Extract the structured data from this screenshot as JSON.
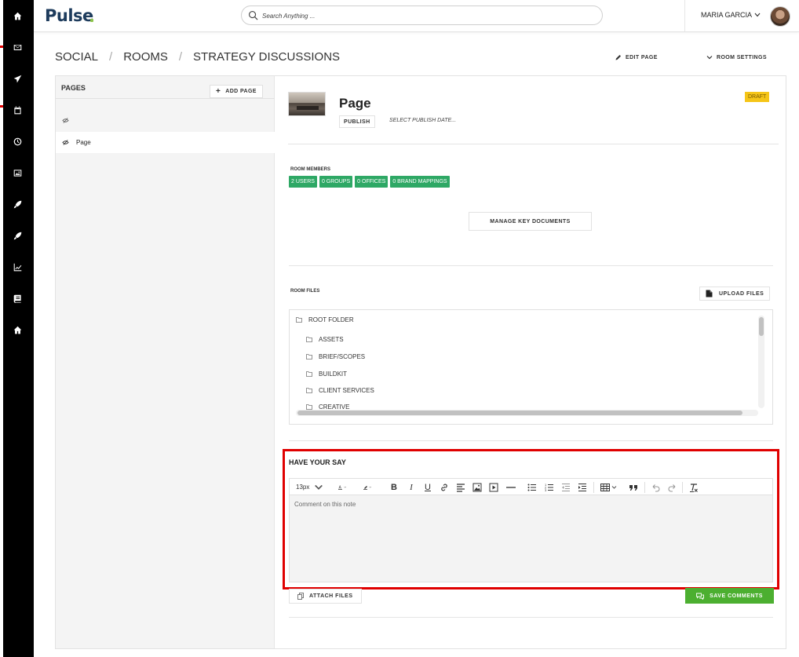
{
  "app": {
    "logo": "Pulse",
    "search_placeholder": "Search Anything ...",
    "user_name": "MARIA GARCIA"
  },
  "rail": {
    "icons": [
      "home-icon",
      "mail-icon",
      "send-icon",
      "calendar-icon",
      "clock-icon",
      "image-icon",
      "rocket-icon",
      "rocket-alt-icon",
      "chart-icon",
      "book-icon",
      "home-alt-icon"
    ]
  },
  "header": {
    "breadcrumb": [
      "SOCIAL",
      "ROOMS",
      "STRATEGY DISCUSSIONS"
    ],
    "separator": "/",
    "edit_page": "EDIT PAGE",
    "room_settings": "ROOM SETTINGS"
  },
  "pages": {
    "title": "PAGES",
    "add_label": "ADD PAGE",
    "items": [
      {
        "label": ""
      },
      {
        "label": "Page",
        "active": true
      }
    ]
  },
  "page": {
    "title": "Page",
    "publish_label": "PUBLISH",
    "publish_date_placeholder": "SELECT PUBLISH DATE...",
    "status": "DRAFT"
  },
  "members": {
    "label": "ROOM MEMBERS",
    "badges": [
      "2 USERS",
      "0 GROUPS",
      "0 OFFICES",
      "0 BRAND MAPPINGS"
    ],
    "manage_docs": "MANAGE KEY DOCUMENTS"
  },
  "files": {
    "label": "ROOM FILES",
    "upload_label": "UPLOAD FILES",
    "root": "ROOT FOLDER",
    "folders": [
      "ASSETS",
      "BRIEF/SCOPES",
      "BUILDKIT",
      "CLIENT SERVICES",
      "CREATIVE"
    ]
  },
  "comments": {
    "title": "HAVE YOUR SAY",
    "font_size": "13px",
    "placeholder": "Comment on this note",
    "attach_label": "ATTACH FILES",
    "save_label": "SAVE COMMENTS"
  },
  "colors": {
    "badge_green": "#2ea865",
    "save_green": "#4caf30",
    "draft_yellow": "#f5c518",
    "highlight_red": "#e00000"
  }
}
